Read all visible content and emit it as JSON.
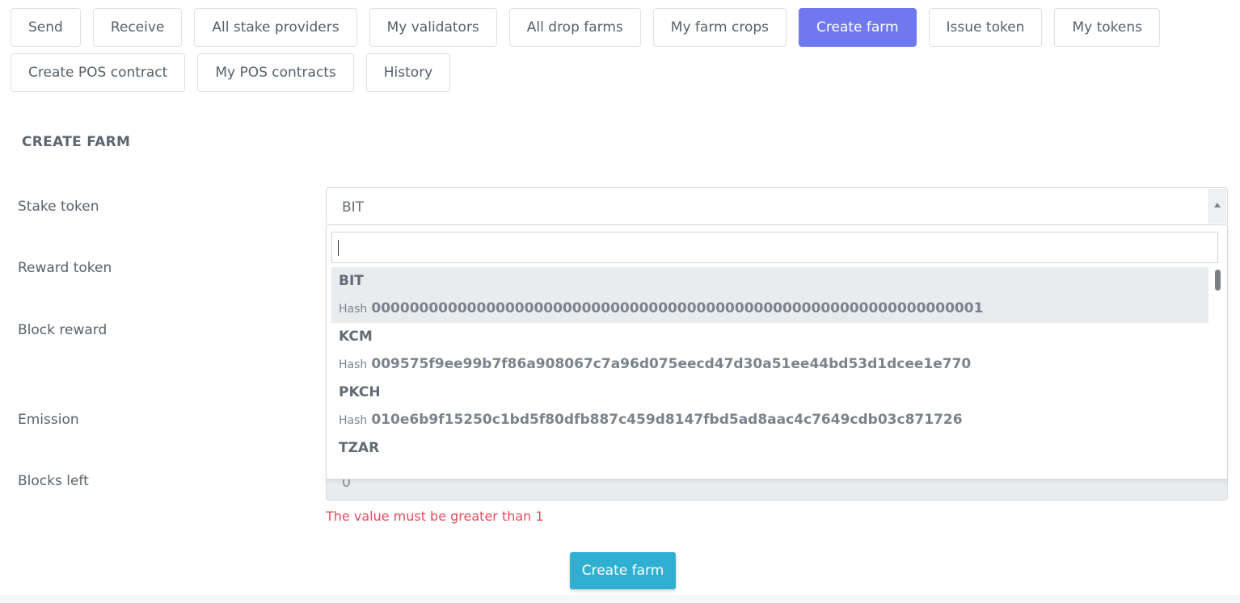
{
  "tabs": {
    "row1": [
      {
        "label": "Send",
        "active": false
      },
      {
        "label": "Receive",
        "active": false
      },
      {
        "label": "All stake providers",
        "active": false
      },
      {
        "label": "My validators",
        "active": false
      },
      {
        "label": "All drop farms",
        "active": false
      },
      {
        "label": "My farm crops",
        "active": false
      },
      {
        "label": "Create farm",
        "active": true
      },
      {
        "label": "Issue token",
        "active": false
      },
      {
        "label": "My tokens",
        "active": false
      }
    ],
    "row2": [
      {
        "label": "Create POS contract",
        "active": false
      },
      {
        "label": "My POS contracts",
        "active": false
      },
      {
        "label": "History",
        "active": false
      }
    ]
  },
  "form": {
    "title": "CREATE FARM",
    "labels": {
      "stake_token": "Stake token",
      "reward_token": "Reward token",
      "block_reward": "Block reward",
      "emission": "Emission",
      "blocks_left": "Blocks left"
    },
    "stake_token_value": "BIT",
    "blocks_left_value": "0",
    "blocks_left_error": "The value must be greater than 1",
    "submit_label": "Create farm"
  },
  "dropdown": {
    "search_value": "",
    "hash_label": "Hash",
    "options": [
      {
        "symbol": "BIT",
        "hash": "0000000000000000000000000000000000000000000000000000000000000001",
        "highlighted": true
      },
      {
        "symbol": "KCM",
        "hash": "009575f9ee99b7f86a908067c7a96d075eecd47d30a51ee44bd53d1dcee1e770",
        "highlighted": false
      },
      {
        "symbol": "PKCH",
        "hash": "010e6b9f15250c1bd5f80dfb887c459d8147fbd5ad8aac4c7649cdb03c871726",
        "highlighted": false
      },
      {
        "symbol": "TZAR",
        "hash": "",
        "highlighted": false
      }
    ]
  },
  "colors": {
    "active_tab": "#7078f0",
    "submit_button": "#30b0d1",
    "error_text": "#e84a5f"
  }
}
